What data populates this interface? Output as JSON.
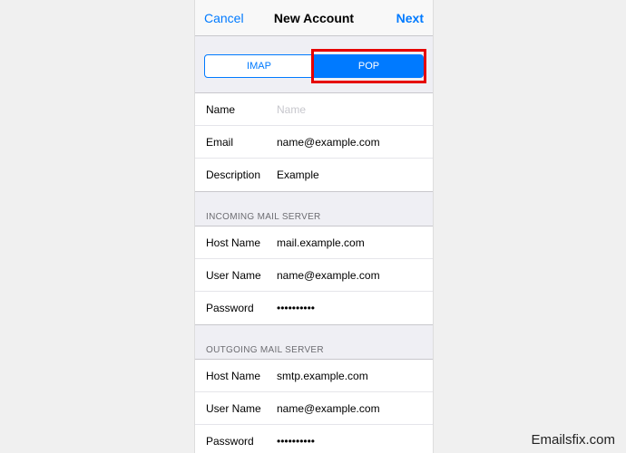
{
  "nav": {
    "cancel": "Cancel",
    "title": "New Account",
    "next": "Next"
  },
  "tabs": {
    "imap": "IMAP",
    "pop": "POP"
  },
  "account": {
    "name_label": "Name",
    "name_placeholder": "Name",
    "email_label": "Email",
    "email_value": "name@example.com",
    "description_label": "Description",
    "description_value": "Example"
  },
  "incoming": {
    "header": "INCOMING MAIL SERVER",
    "host_label": "Host Name",
    "host_value": "mail.example.com",
    "user_label": "User Name",
    "user_value": "name@example.com",
    "password_label": "Password",
    "password_value": "••••••••••"
  },
  "outgoing": {
    "header": "OUTGOING MAIL SERVER",
    "host_label": "Host Name",
    "host_value": "smtp.example.com",
    "user_label": "User Name",
    "user_value": "name@example.com",
    "password_label": "Password",
    "password_value": "••••••••••"
  },
  "watermark": "Emailsfix.com"
}
